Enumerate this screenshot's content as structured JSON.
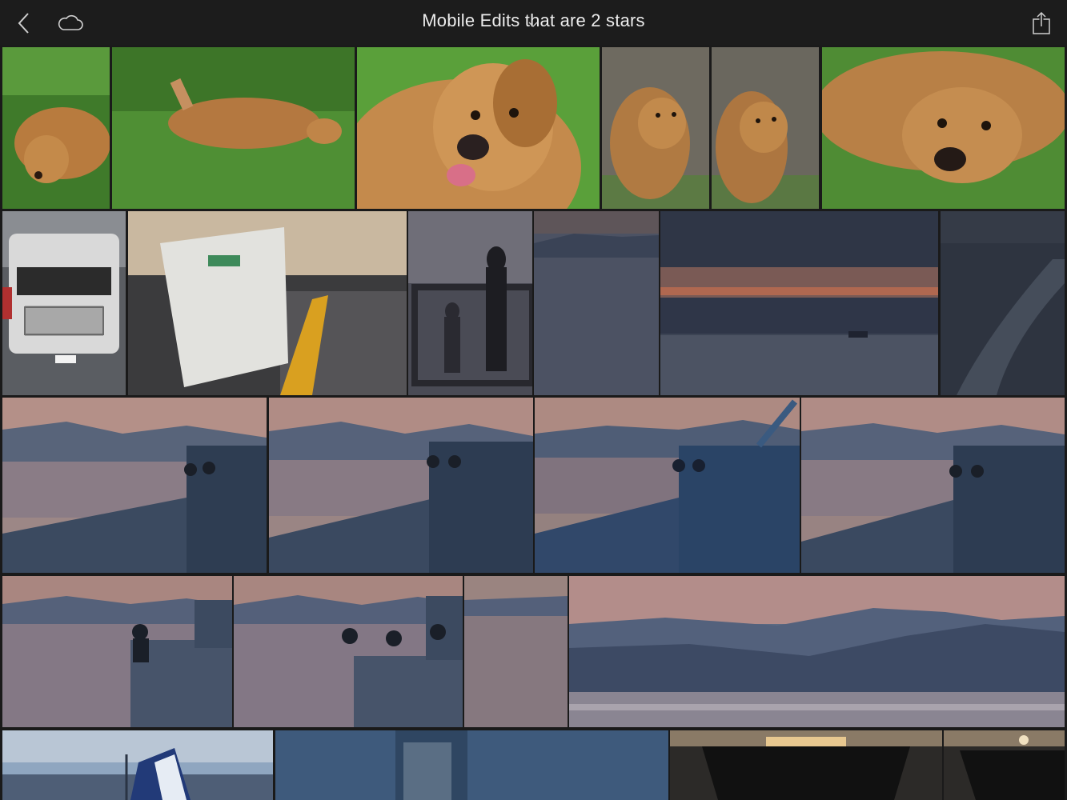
{
  "header": {
    "title": "Mobile Edits that are 2 stars",
    "back_icon": "chevron-left-icon",
    "cloud_icon": "cloud-icon",
    "title_dropdown_icon": "chevron-down-icon",
    "share_icon": "share-icon"
  },
  "colors": {
    "background": "#1a1a1a",
    "topbar": "#1c1c1c",
    "title_text": "#ececec"
  },
  "grid": {
    "rows": [
      {
        "photos": [
          "dog lying on grass",
          "dog rolling on grass",
          "dog close-up smiling",
          "dog portrait by wall",
          "dog portrait by wall",
          "dog resting head on grass"
        ]
      },
      {
        "photos": [
          "RV motorhome front",
          "ferry terminal sign and fence",
          "silhouette on ferry railing",
          "dusk water and hills",
          "sunset clouds over water",
          "ferry wake on water"
        ]
      },
      {
        "photos": [
          "people on ferry deck at dusk",
          "people on ferry deck at dusk",
          "people on ferry deck at dusk",
          "people on ferry deck at dusk"
        ]
      },
      {
        "photos": [
          "person on ferry deck at dusk",
          "people on ferry deck at dusk",
          "people at ferry railing",
          "hills over water at dusk"
        ]
      },
      {
        "photos": [
          "ferry funnel at dusk",
          "ferry side at dusk",
          "ferry car deck interior",
          "ferry car deck interior"
        ]
      }
    ]
  }
}
